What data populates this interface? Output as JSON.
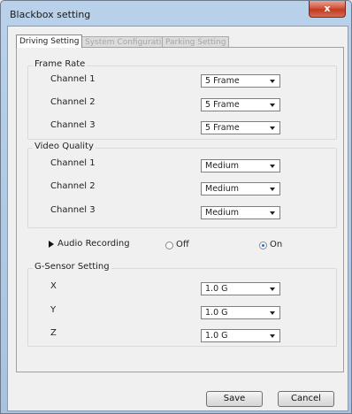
{
  "window": {
    "title": "Blackbox setting",
    "close_glyph": "x"
  },
  "tabs": [
    {
      "label": "Driving Setting",
      "active": true
    },
    {
      "label": "System Configuration",
      "active": false
    },
    {
      "label": "Parking Setting",
      "active": false
    }
  ],
  "frame_rate": {
    "title": "Frame Rate",
    "rows": [
      {
        "label": "Channel 1",
        "value": "5 Frame"
      },
      {
        "label": "Channel 2",
        "value": "5 Frame"
      },
      {
        "label": "Channel 3",
        "value": "5 Frame"
      }
    ]
  },
  "video_quality": {
    "title": "Video Quality",
    "rows": [
      {
        "label": "Channel 1",
        "value": "Medium"
      },
      {
        "label": "Channel 2",
        "value": "Medium"
      },
      {
        "label": "Channel 3",
        "value": "Medium"
      }
    ]
  },
  "audio": {
    "label": "Audio Recording",
    "off_label": "Off",
    "on_label": "On",
    "selected": "On"
  },
  "gsensor": {
    "title": "G-Sensor Setting",
    "rows": [
      {
        "label": "X",
        "value": "1.0 G"
      },
      {
        "label": "Y",
        "value": "1.0 G"
      },
      {
        "label": "Z",
        "value": "1.0 G"
      }
    ]
  },
  "buttons": {
    "save": "Save",
    "cancel": "Cancel"
  },
  "colors": {
    "radio_selected": "#2a6fcf",
    "close_button": "#c23a20"
  }
}
